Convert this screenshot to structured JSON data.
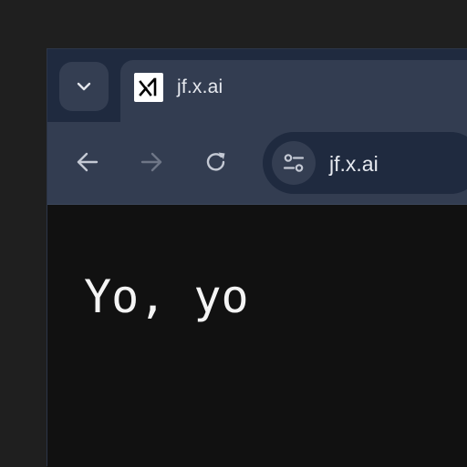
{
  "tab": {
    "title": "jf.x.ai",
    "favicon": "x-ai-logo-icon"
  },
  "toolbar": {
    "back_icon": "arrow-left-icon",
    "forward_icon": "arrow-right-icon",
    "reload_icon": "reload-icon"
  },
  "omnibox": {
    "url": "jf.x.ai",
    "site_info_icon": "tune-icon"
  },
  "page": {
    "text": "Yo, yo"
  },
  "colors": {
    "tabstrip": "#1f2a3f",
    "toolbar": "#333d51",
    "page_bg": "#111111",
    "text": "#f4f4f4",
    "icon_active": "#c4c9d4",
    "icon_disabled": "#6e7687"
  }
}
